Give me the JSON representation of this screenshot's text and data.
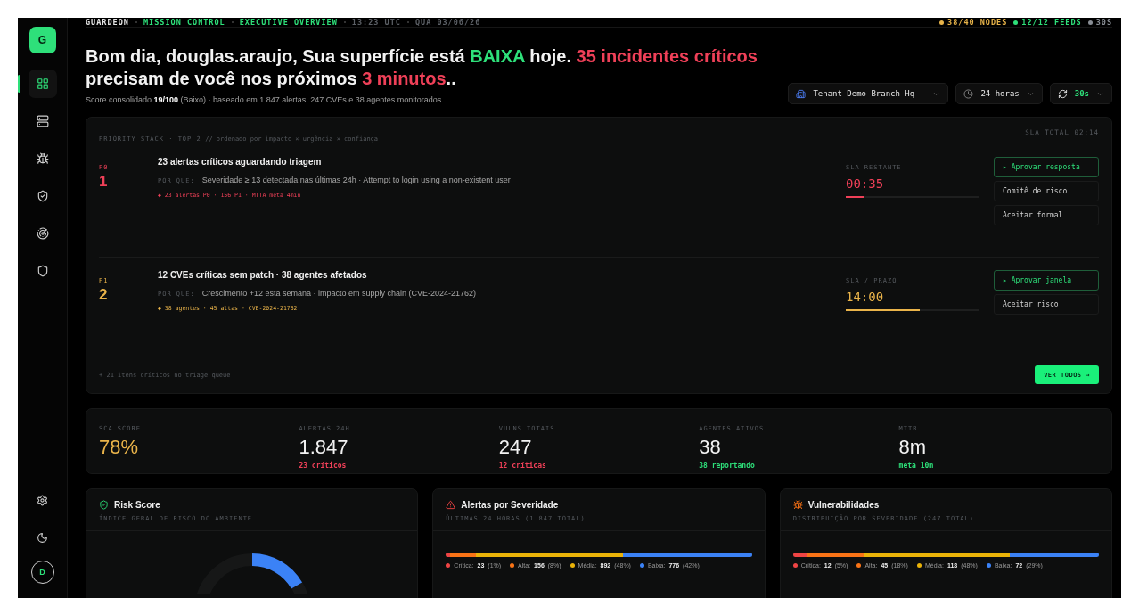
{
  "sidebar": {
    "logo": "G",
    "items": [
      {
        "selected": true
      },
      {
        "selected": false
      },
      {
        "selected": false
      },
      {
        "selected": false
      },
      {
        "selected": false
      },
      {
        "selected": false
      }
    ],
    "avatar": "D"
  },
  "header": {
    "breadcrumb": [
      {
        "text": "GUARDEON",
        "color": "#e6e6e6"
      },
      {
        "text": "MISSION CONTROL",
        "color": "#2ee07a"
      },
      {
        "text": "EXECUTIVE OVERVIEW",
        "color": "#2ee07a"
      },
      {
        "text": "13:23 UTC",
        "color": "#5c6066"
      },
      {
        "text": "QUA 03/06/26",
        "color": "#5c6066"
      }
    ],
    "status": [
      {
        "text": "38/40 NODES",
        "color": "#e8b44a"
      },
      {
        "text": "12/12 FEEDS",
        "color": "#2ee07a"
      },
      {
        "text": "30S",
        "color": "#8a8f96"
      }
    ]
  },
  "hero": {
    "title": [
      {
        "text": "Bom dia, douglas.araujo, Sua superfície está ",
        "color": "#f2f2f2"
      },
      {
        "text": "BAIXA",
        "color": "#2ee07a"
      },
      {
        "text": " hoje. ",
        "color": "#f2f2f2"
      },
      {
        "text": "35 incidentes críticos",
        "color": "#ef4058"
      },
      {
        "text": " precisam de você nos próximos ",
        "color": "#f2f2f2"
      },
      {
        "text": "3 minutos",
        "color": "#ef4058"
      },
      {
        "text": "..",
        "color": "#f2f2f2"
      }
    ],
    "subtitle": "Score consolidado **19/100** (Baixo) · baseado em 1.847 alertas, 247 CVEs e 38 agentes monitorados.",
    "tenant": "Tenant Demo Branch Hq",
    "range": "24 horas",
    "refresh": "30s"
  },
  "priority": {
    "heading": "PRIORITY STACK · TOP 2",
    "comment": "// ordenado por impacto × urgência × confiança",
    "sla_total": "SLA TOTAL 02:14",
    "items": [
      {
        "priority": "P0",
        "rank": "1",
        "color": "#ef4058",
        "title": "23 alertas críticos aguardando triagem",
        "why_label": "POR QUE:",
        "why": "Severidade ≥ 13 detectada nas últimas 24h · Attempt to login using a non-existent user",
        "meta": "◆ 23 alertas P0 · 156 P1 · MTTA meta 4min",
        "sla_label": "SLA RESTANTE",
        "sla": "00:35",
        "level": 0.13,
        "actions": [
          {
            "label": "▸ Aprovar resposta",
            "primary": true
          },
          {
            "label": "Comitê de risco",
            "primary": false
          },
          {
            "label": "Aceitar formal",
            "primary": false
          }
        ]
      },
      {
        "priority": "P1",
        "rank": "2",
        "color": "#eab44a",
        "title": "12 CVEs críticas sem patch · 38 agentes afetados",
        "why_label": "POR QUE:",
        "why": "Crescimento +12 esta semana · impacto em supply chain (CVE-2024-21762)",
        "meta": "◆ 38 agentes · 45 altas · CVE-2024-21762",
        "sla_label": "SLA / PRAZO",
        "sla": "14:00",
        "level": 0.55,
        "actions": [
          {
            "label": "▸ Aprovar janela",
            "primary": true
          },
          {
            "label": "Aceitar risco",
            "primary": false
          }
        ]
      }
    ],
    "footer": "+ 21 itens críticos no triage queue",
    "cta": "VER TODOS →"
  },
  "kpis": [
    {
      "label": "SCA SCORE",
      "value": "78%",
      "color": "#eab44a"
    },
    {
      "label": "ALERTAS 24H",
      "value": "1.847",
      "note": "23 críticos",
      "color": "#ef4058"
    },
    {
      "label": "VULNS TOTAIS",
      "value": "247",
      "note": "12 críticas",
      "color": "#ef4058"
    },
    {
      "label": "AGENTES ATIVOS",
      "value": "38",
      "note": "38 reportando",
      "color": "#2ee07a"
    },
    {
      "label": "MTTR",
      "value": "8m",
      "note": "meta 10m",
      "color": "#2ee07a"
    }
  ],
  "cards": [
    {
      "kind": "gauge",
      "title": "Risk Score",
      "subtitle": "ÍNDICE GERAL DE RISCO DO AMBIENTE"
    },
    {
      "kind": "bar",
      "title": "Alertas por Severidade",
      "subtitle": "ÚLTIMAS 24 HORAS (1.847 TOTAL)",
      "segments": [
        {
          "name": "Crítica:",
          "count": "23",
          "pct": "(1%)",
          "color": "#ef4444"
        },
        {
          "name": "Alta:",
          "count": "156",
          "pct": "(8%)",
          "color": "#f97316"
        },
        {
          "name": "Média:",
          "count": "892",
          "pct": "(48%)",
          "color": "#eab308"
        },
        {
          "name": "Baixa:",
          "count": "776",
          "pct": "(42%)",
          "color": "#3b82f6"
        }
      ]
    },
    {
      "kind": "bar",
      "title": "Vulnerabilidades",
      "subtitle": "DISTRIBUIÇÃO POR SEVERIDADE (247 TOTAL)",
      "segments": [
        {
          "name": "Crítica:",
          "count": "12",
          "pct": "(5%)",
          "color": "#ef4444"
        },
        {
          "name": "Alta:",
          "count": "45",
          "pct": "(18%)",
          "color": "#f97316"
        },
        {
          "name": "Média:",
          "count": "118",
          "pct": "(48%)",
          "color": "#eab308"
        },
        {
          "name": "Baixa:",
          "count": "72",
          "pct": "(29%)",
          "color": "#3b82f6"
        }
      ]
    }
  ]
}
